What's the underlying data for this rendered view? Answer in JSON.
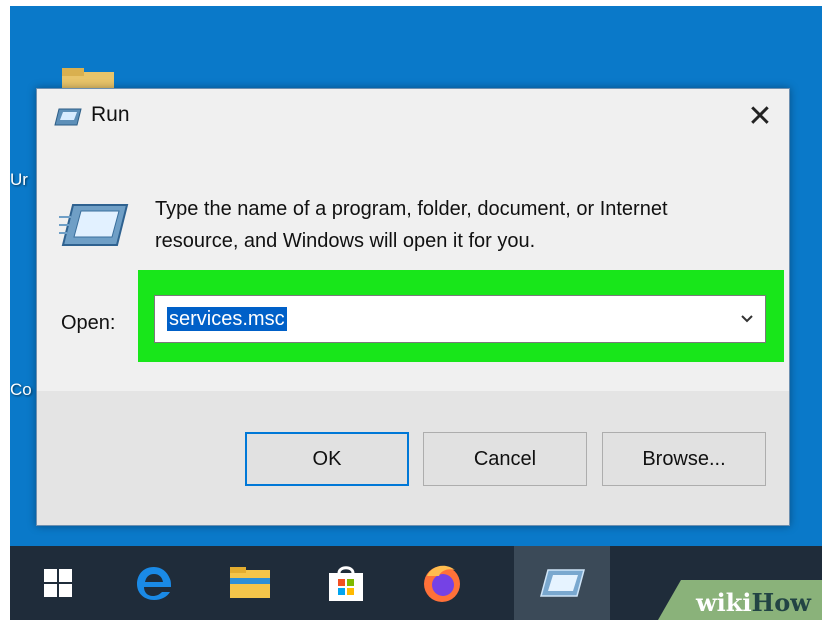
{
  "desktop": {
    "partial_label_1": "Ur",
    "partial_label_2": "Co"
  },
  "dialog": {
    "title": "Run",
    "close_glyph": "✕",
    "description": "Type the name of a program, folder, document, or Internet resource, and Windows will open it for you.",
    "open_label": "Open:",
    "open_value": "services.msc",
    "buttons": {
      "ok": "OK",
      "cancel": "Cancel",
      "browse": "Browse..."
    }
  },
  "taskbar": {
    "items": [
      "windows-start-icon",
      "edge-icon",
      "file-explorer-icon",
      "store-icon",
      "firefox-icon",
      "run-icon"
    ],
    "active_item": "run-icon"
  },
  "watermark": {
    "wiki": "wiki",
    "how": "How"
  },
  "colors": {
    "desktop": "#0a79c9",
    "highlight": "#18e61a",
    "taskbar": "#1f2c3a",
    "selection": "#0060c8"
  }
}
